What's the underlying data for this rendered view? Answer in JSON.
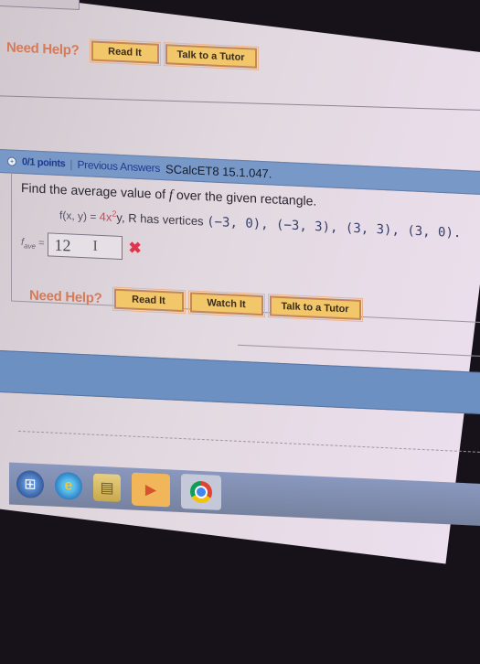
{
  "top_help": {
    "label": "Need Help?",
    "buttons": [
      "Read It",
      "Talk to a Tutor"
    ]
  },
  "question": {
    "points": "0/1 points",
    "separator": "|",
    "previous_answers": "Previous Answers",
    "code": "SCalcET8 15.1.047.",
    "prompt_before": "Find the average value of ",
    "prompt_var": "f",
    "prompt_after": " over the given rectangle.",
    "function_lhs": "f(x, y) = ",
    "function_rhs_coef": "4x",
    "function_rhs_exp": "2",
    "function_rhs_tail": "y",
    "region_text": ", R has vertices ",
    "vertices": "(−3, 0), (−3, 3), (3, 3), (3, 0).",
    "answer_label": "f",
    "answer_sub": "ave",
    "answer_eq": " =",
    "answer_value": "12",
    "answer_status": "incorrect"
  },
  "bottom_help": {
    "label": "Need Help?",
    "buttons": [
      "Read It",
      "Watch It",
      "Talk to a Tutor"
    ]
  },
  "taskbar": {
    "icons": [
      "windows-start",
      "internet-explorer",
      "file-explorer",
      "media-player",
      "google-chrome"
    ]
  },
  "colors": {
    "header_blue": "#7898c8",
    "button_gold": "#f1c76a",
    "help_orange": "#d47b5a",
    "wrong_red": "#e0344c"
  }
}
